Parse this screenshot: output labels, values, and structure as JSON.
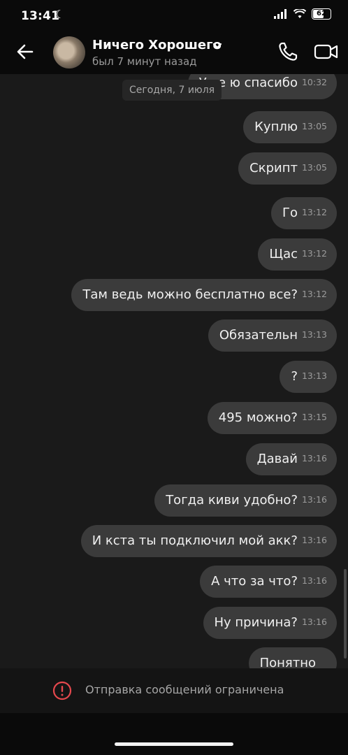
{
  "status_bar": {
    "time": "13:41",
    "battery": "62",
    "battery_level": 0.62
  },
  "header": {
    "contact_name": "Ничего Хорошего",
    "last_seen": "был 7 минут назад"
  },
  "chat": {
    "date_divider": "Сегодня, 7 июля",
    "messages": [
      {
        "text": "Уже   ю спасибо",
        "time": "10:32"
      },
      {
        "text": "Куплю",
        "time": "13:05"
      },
      {
        "text": "Скрипт",
        "time": "13:05"
      },
      {
        "text": "Го",
        "time": "13:12"
      },
      {
        "text": "Щас",
        "time": "13:12"
      },
      {
        "text": "Там ведь можно бесплатно все?",
        "time": "13:12"
      },
      {
        "text": "Обязательн",
        "time": "13:13"
      },
      {
        "text": "?",
        "time": "13:13"
      },
      {
        "text": "495 можно?",
        "time": "13:15"
      },
      {
        "text": "Давай",
        "time": "13:16"
      },
      {
        "text": "Тогда киви удобно?",
        "time": "13:16"
      },
      {
        "text": "И кста ты подключил мой акк?",
        "time": "13:16"
      },
      {
        "text": "А что за что?",
        "time": "13:16"
      },
      {
        "text": "Ну причина?",
        "time": "13:16"
      },
      {
        "text": "Понятно",
        "time": ""
      }
    ]
  },
  "footer": {
    "restricted_text": "Отправка сообщений ограничена"
  },
  "colors": {
    "bubble": "#3b3b3b",
    "chat_bg": "#1a1a1a",
    "warning": "#e5484d"
  }
}
